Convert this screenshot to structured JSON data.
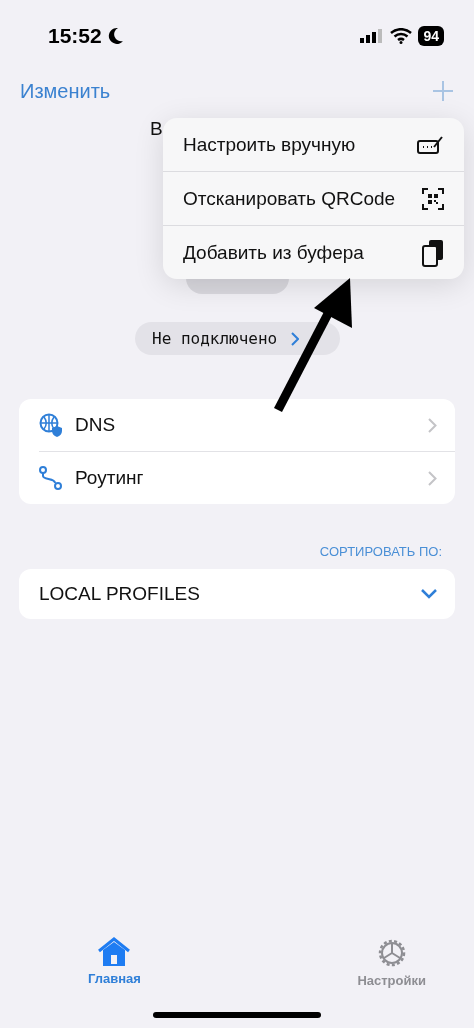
{
  "status_bar": {
    "time": "15:52",
    "battery": "94"
  },
  "nav": {
    "edit": "Изменить"
  },
  "hero": {
    "title": "В",
    "status": "Не подключено"
  },
  "menu": [
    {
      "label": "Настроить вручную",
      "kind": "manual"
    },
    {
      "label": "Отсканировать QRCode",
      "kind": "qr"
    },
    {
      "label": "Добавить из буфера",
      "kind": "clipboard"
    }
  ],
  "settings": [
    {
      "label": "DNS",
      "kind": "dns"
    },
    {
      "label": "Роутинг",
      "kind": "routing"
    }
  ],
  "sort_label": "СОРТИРОВАТЬ ПО:",
  "profiles": {
    "label": "LOCAL PROFILES",
    "expanded": true
  },
  "tabs": [
    {
      "label": "Главная",
      "kind": "home",
      "selected": true
    },
    {
      "label": "Настройки",
      "kind": "settings",
      "selected": false
    }
  ]
}
